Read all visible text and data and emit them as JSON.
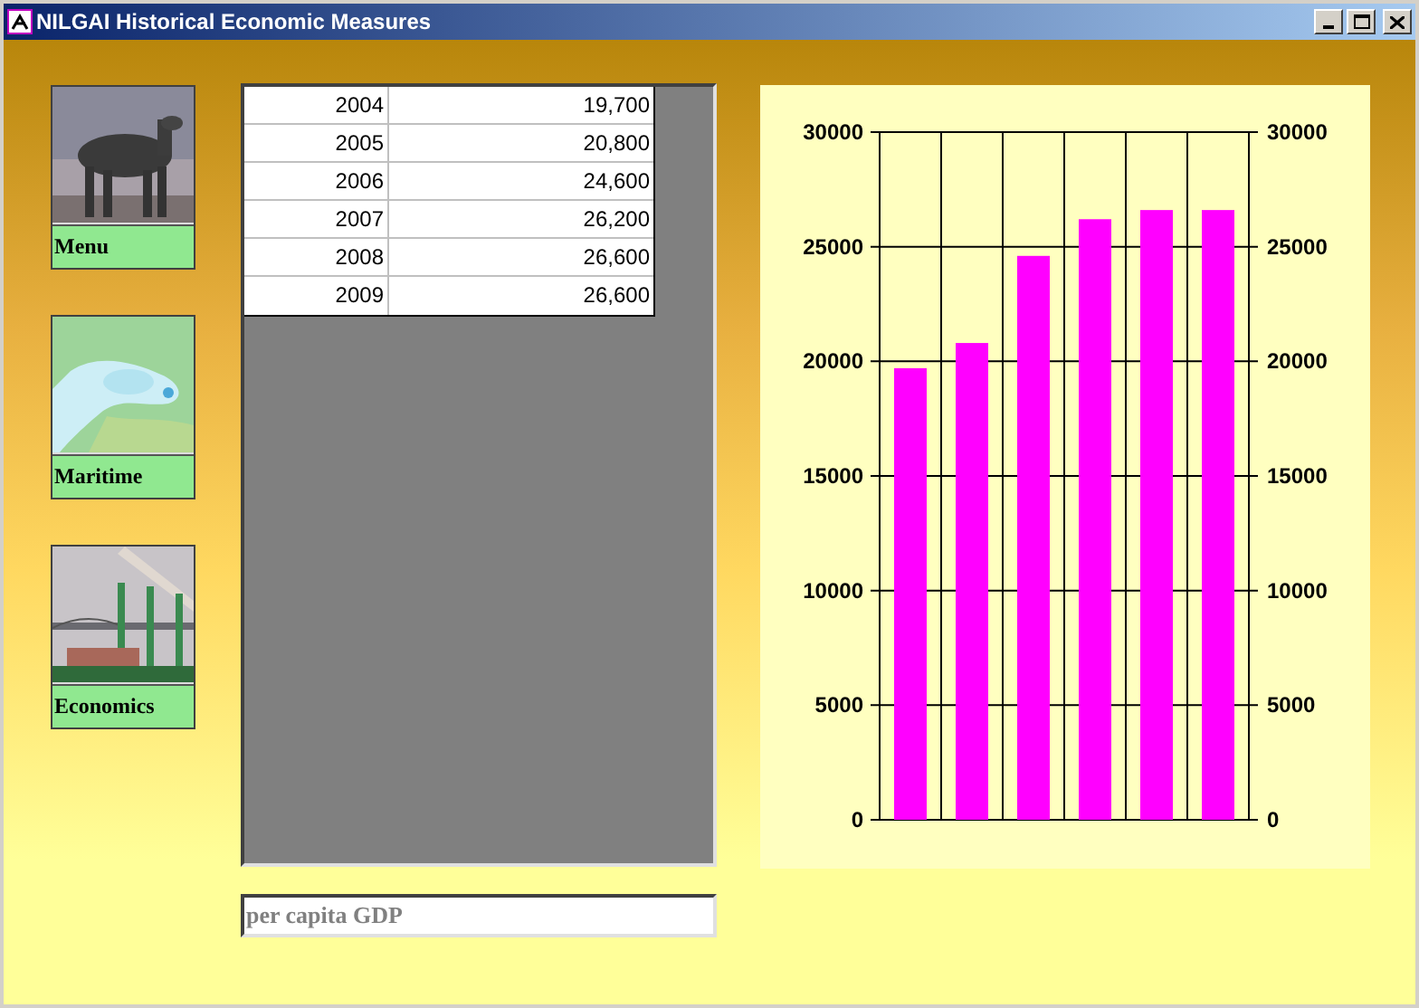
{
  "window": {
    "title": "NILGAI Historical Economic Measures"
  },
  "nav": [
    {
      "label": "Menu",
      "kind": "picture"
    },
    {
      "label": "Maritime",
      "kind": "picture"
    },
    {
      "label": "Economics",
      "kind": "picture"
    }
  ],
  "table": {
    "rows": [
      [
        "2004",
        "19,700"
      ],
      [
        "2005",
        "20,800"
      ],
      [
        "2006",
        "24,600"
      ],
      [
        "2007",
        "26,200"
      ],
      [
        "2008",
        "26,600"
      ],
      [
        "2009",
        "26,600"
      ]
    ]
  },
  "chart": {
    "chart_data": {
      "type": "bar",
      "grid": true,
      "series": [
        {
          "color": "#ff00ff",
          "values": [
            19700,
            20800,
            24600,
            26200,
            26600,
            26600
          ]
        }
      ],
      "ylim": [
        0,
        30000
      ],
      "yticks": [
        0,
        5000,
        10000,
        15000,
        20000,
        25000,
        30000
      ],
      "y2lim": [
        0,
        30000
      ],
      "y2ticks": [
        0,
        5000,
        10000,
        15000,
        20000,
        25000,
        30000
      ]
    }
  },
  "field": {
    "value": "per capita GDP"
  }
}
